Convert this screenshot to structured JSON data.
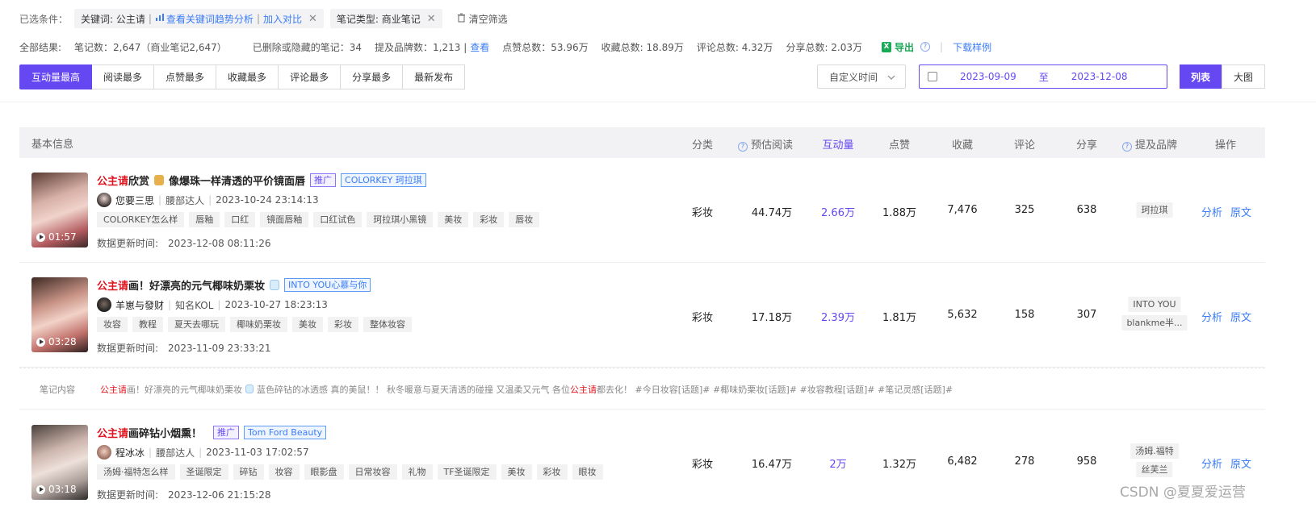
{
  "filters": {
    "label": "已选条件：",
    "keyword_prefix": "关键词: 公主请",
    "keyword_sep": "|",
    "keyword_trend_link": "查看关键词趋势分析",
    "keyword_compare_link": "加入对比",
    "note_type": "笔记类型: 商业笔记",
    "clear": "清空筛选"
  },
  "summary": {
    "total_label": "全部结果:",
    "note_count": "笔记数：2,647（商业笔记2,647）",
    "deleted": "已删除或隐藏的笔记：34",
    "brand_count": "提及品牌数：1,213 |",
    "brand_view": "查看",
    "likes_total": "点赞总数：53.96万",
    "collect_total": "收藏总数: 18.89万",
    "comment_total": "评论总数: 4.32万",
    "share_total": "分享总数: 2.03万",
    "export": "导出",
    "pipe": "|",
    "download_sample": "下载样例"
  },
  "sort_tabs": [
    "互动量最高",
    "阅读最多",
    "点赞最多",
    "收藏最多",
    "评论最多",
    "分享最多",
    "最新发布"
  ],
  "time_select": "自定义时间",
  "date_range": {
    "start": "2023-09-09",
    "to": "至",
    "end": "2023-12-08"
  },
  "view_toggle": {
    "list": "列表",
    "grid": "大图"
  },
  "columns": {
    "basic": "基本信息",
    "category": "分类",
    "est_reads": "预估阅读",
    "interaction": "互动量",
    "likes": "点赞",
    "collects": "收藏",
    "comments": "评论",
    "shares": "分享",
    "brands": "提及品牌",
    "ops": "操作"
  },
  "rows": [
    {
      "title_kw": "公主请",
      "title_rest": "欣赏",
      "title_tail": "像爆珠一样清透的平价镜面唇",
      "promo": "推广",
      "brand_tag": "COLORKEY 珂拉琪",
      "duration": "01:57",
      "author": "您要三思",
      "author_type": "腰部达人",
      "publish_time": "2023-10-24 23:14:13",
      "tags": [
        "COLORKEY怎么样",
        "唇釉",
        "口红",
        "镜面唇釉",
        "口红试色",
        "珂拉琪小黑镜",
        "美妆",
        "彩妆",
        "唇妆"
      ],
      "update_label": "数据更新时间:",
      "update_time": "2023-12-08 08:11:26",
      "category": "彩妆",
      "est_reads": "44.74万",
      "interaction": "2.66万",
      "likes": "1.88万",
      "collects": "7,476",
      "comments": "325",
      "shares": "638",
      "brands": [
        "珂拉琪"
      ],
      "op_analyze": "分析",
      "op_source": "原文"
    },
    {
      "title_kw": "公主请",
      "title_rest": "画！好漂亮的元气椰味奶栗妆",
      "promo": "",
      "brand_tag": "INTO YOU心慕与你",
      "duration": "03:28",
      "author": "羊崽与發财",
      "author_type": "知名KOL",
      "publish_time": "2023-10-27 18:23:13",
      "tags": [
        "妆容",
        "教程",
        "夏天去哪玩",
        "椰味奶栗妆",
        "美妆",
        "彩妆",
        "整体妆容"
      ],
      "update_label": "数据更新时间:",
      "update_time": "2023-11-09 23:33:21",
      "category": "彩妆",
      "est_reads": "17.18万",
      "interaction": "2.39万",
      "likes": "1.81万",
      "collects": "5,632",
      "comments": "158",
      "shares": "307",
      "brands": [
        "INTO YOU",
        "blankme半..."
      ],
      "op_analyze": "分析",
      "op_source": "原文"
    },
    {
      "title_kw": "公主请",
      "title_rest": "画碎钻小烟熏！",
      "promo": "推广",
      "brand_tag": "Tom Ford Beauty",
      "duration": "03:18",
      "author": "程冰冰",
      "author_type": "腰部达人",
      "publish_time": "2023-11-03 17:02:57",
      "tags": [
        "汤姆·福特怎么样",
        "圣诞限定",
        "碎钻",
        "妆容",
        "眼影盘",
        "日常妆容",
        "礼物",
        "TF圣诞限定",
        "美妆",
        "彩妆",
        "眼妆"
      ],
      "update_label": "数据更新时间:",
      "update_time": "2023-12-06 21:15:28",
      "category": "彩妆",
      "est_reads": "16.47万",
      "interaction": "2万",
      "likes": "1.32万",
      "collects": "6,482",
      "comments": "278",
      "shares": "958",
      "brands": [
        "汤姆.福特",
        "丝芙兰"
      ],
      "op_analyze": "分析",
      "op_source": "原文"
    }
  ],
  "note_content": {
    "label": "笔记内容",
    "kw1": "公主请",
    "part1": "画！好漂亮的元气椰味奶栗妆",
    "part2": "蓝色碎钻的冰透感 真的美鼠！！ 秋冬暖意与夏天清透的碰撞 又温柔又元气 各位",
    "kw2": "公主请",
    "part3": "都去化！ #今日妆容[话题]# #椰味奶栗妆[话题]# #妆容教程[话题]# #笔记灵感[话题]#"
  },
  "watermark": "CSDN @夏夏爱运营",
  "colors": {
    "accent": "#6548f2",
    "link": "#3a7cf6",
    "keyword": "#e0141e",
    "export": "#1aaa55"
  }
}
